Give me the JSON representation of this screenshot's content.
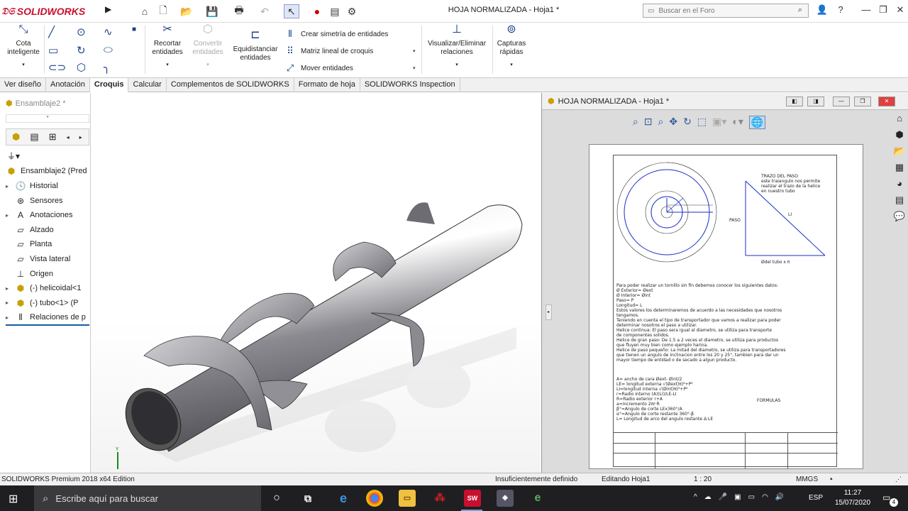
{
  "app": {
    "brand": "SOLIDWORKS",
    "doc_title": "HOJA NORMALIZADA - Hoja1 *"
  },
  "search": {
    "placeholder": "Buscar en el Foro"
  },
  "ribbon": {
    "cota": "Cota\ninteligente",
    "recortar": "Recortar\nentidades",
    "convertir": "Convertir\nentidades",
    "equidistanciar": "Equidistanciar\nentidades",
    "simetria": "Crear simetría de entidades",
    "matriz": "Matriz lineal de croquis",
    "mover": "Mover entidades",
    "visualizar": "Visualizar/Eliminar\nrelaciones",
    "capturas": "Capturas\nrápidas"
  },
  "tabs": [
    "Ver diseño",
    "Anotación",
    "Croquis",
    "Calcular",
    "Complementos de SOLIDWORKS",
    "Formato de hoja",
    "SOLIDWORKS Inspection"
  ],
  "active_tab": "Croquis",
  "tree": {
    "root": "Ensamblaje2  (Pred",
    "items": [
      {
        "label": "Historial",
        "icon": "history-icon"
      },
      {
        "label": "Sensores",
        "icon": "sensor-icon"
      },
      {
        "label": "Anotaciones",
        "icon": "annotation-icon"
      },
      {
        "label": "Alzado",
        "icon": "plane-icon"
      },
      {
        "label": "Planta",
        "icon": "plane-icon"
      },
      {
        "label": "Vista lateral",
        "icon": "plane-icon"
      },
      {
        "label": "Origen",
        "icon": "origin-icon"
      },
      {
        "label": "(-) helicoidal<1",
        "icon": "part-icon"
      },
      {
        "label": "(-) tubo<1> (P",
        "icon": "part-icon"
      },
      {
        "label": "Relaciones de p",
        "icon": "mate-icon"
      }
    ]
  },
  "viewport": {
    "title": "Ensamblaje2 *"
  },
  "drawing": {
    "window_title": "HOJA NORMALIZADA - Hoja1 *",
    "triangle_title": [
      "TRAZO DEL PASO",
      "este traiangulo nos permite",
      "realizar el trazo de la helice",
      "en nuestro tubo"
    ],
    "label_paso": "PASO",
    "label_li": "LI",
    "label_tubo": "Ødel tubo x π",
    "body_lines": [
      "Para poder realizar un tornillo sin fin debemos conocer los siguientes datos:",
      "Ø Exterior= Øext",
      "Ø Interior= Øint",
      "Paso= P",
      "Longitud= L",
      "Estos valores los determinaremos de acuerdo a las necesidades que nosotros",
      "tengamos.",
      "Teniendo en cuenta el tipo de transportador que vamos a realizar para poder",
      "determinar nosotros el paso a utilizar.",
      "Helice continua: El paso sera igual al diametro, se utiliza para transporte",
      "de componentes solidos.",
      "Helice de gran paso: De 1.5 a 2 veces el diametro, se utiliza para productos",
      "que fluyen muy bien como ejemplo harina.",
      "Helice de paso pequeño: La mitad del diametro, se utiliza para transportadores",
      "que tienen un angulo de inclinacion entre los 20 y 25°, tambien para dar un",
      "mayor tiempo de entidad o de secado a algun producto."
    ],
    "formula_lines": [
      "A= ancho de cara   Øext- Øint/2",
      "LE= longitud externa √(Øext)π)²+P²",
      "LI=longitud interna √(Øint)π)²+P²",
      "r=Radio interno (A)(LI)/LE-LI",
      "R=Radio exterior r+A",
      "a=Incremento 2πr·R",
      "β°=Angulo de corte LEx360°/A",
      "α°=Angulo de corte restante 360°-β",
      "L= Longitud de arco del angulo restante Δ·LE"
    ],
    "formulas_label": "FORMULAS"
  },
  "status": {
    "edition": "SOLIDWORKS Premium 2018 x64 Edition",
    "state": "Insuficientemente definido",
    "editing": "Editando Hoja1",
    "scale": "1 : 20",
    "units": "MMGS"
  },
  "taskbar": {
    "search_placeholder": "Escribe aquí para buscar",
    "lang": "ESP",
    "time": "11:27",
    "date": "15/07/2020",
    "notifications": "4"
  }
}
